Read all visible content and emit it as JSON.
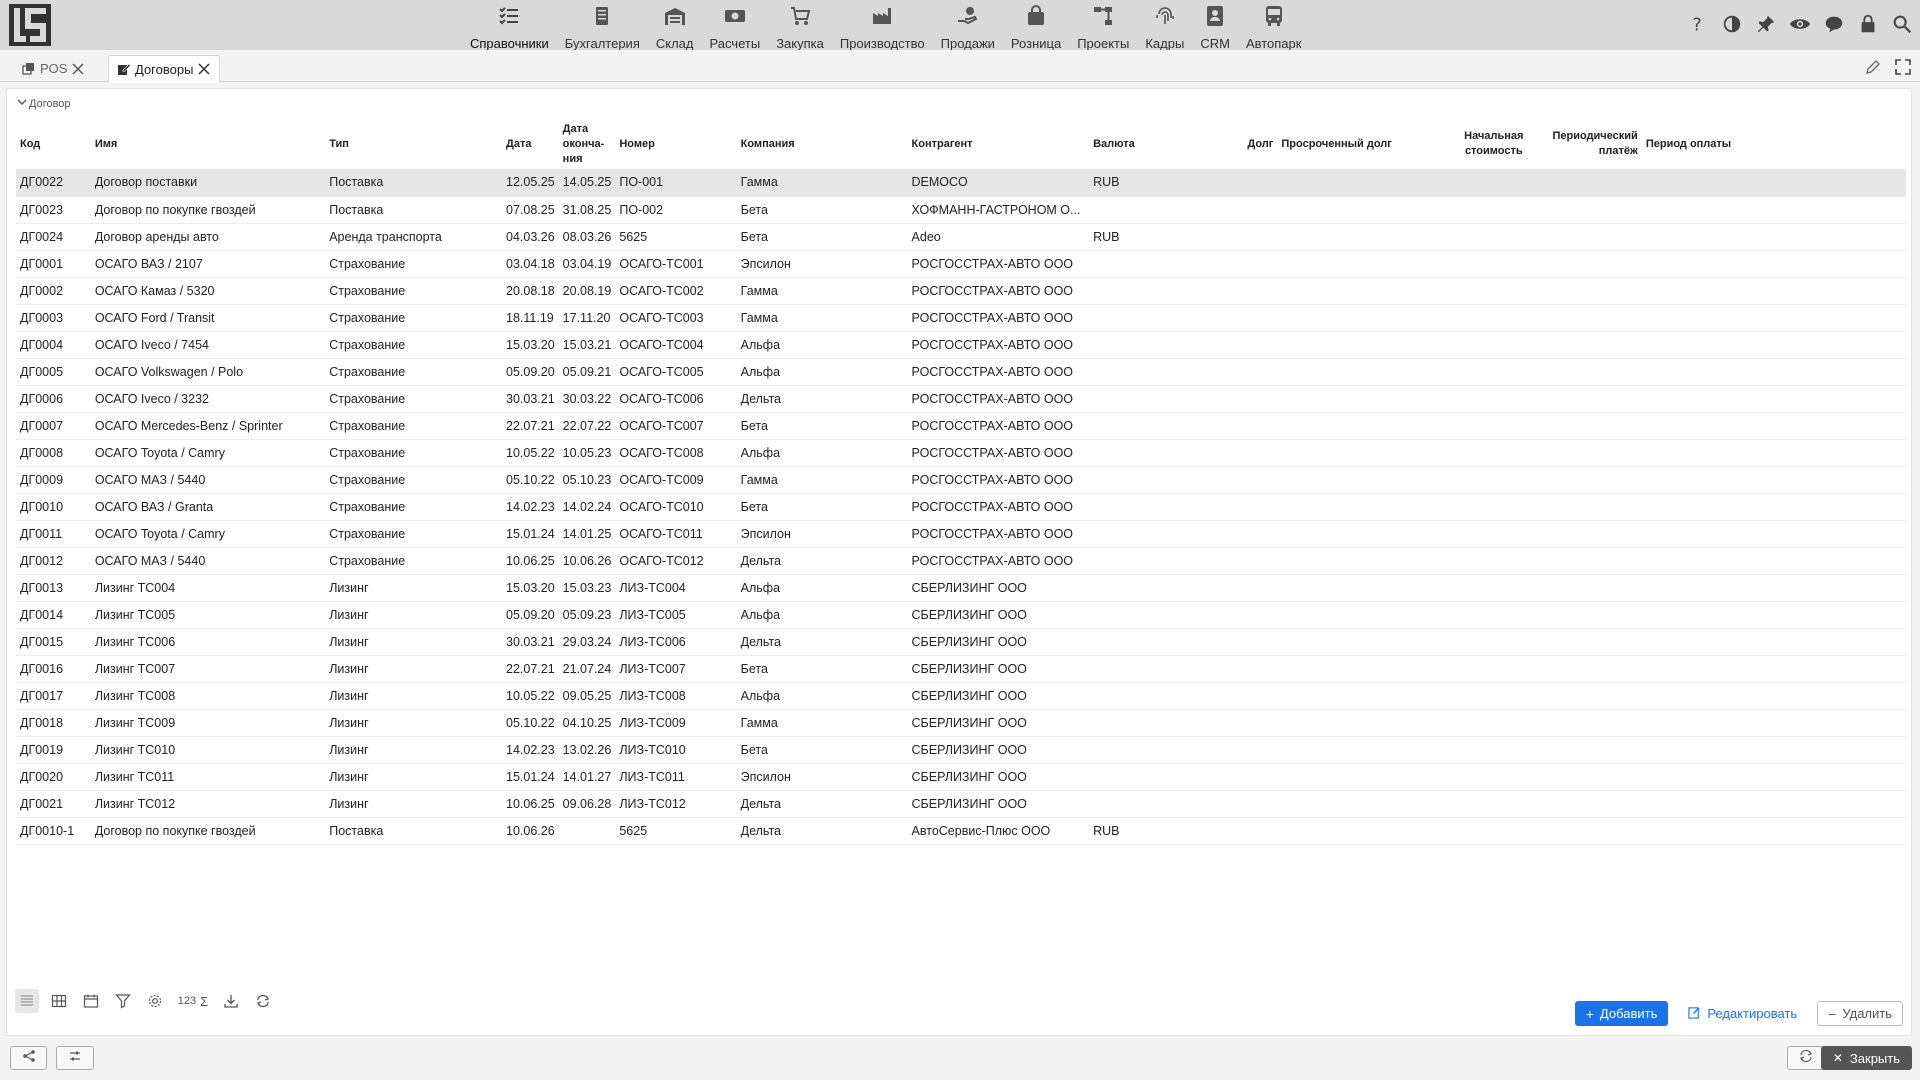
{
  "header": {
    "modules": [
      {
        "label": "Справочники",
        "icon": "list-check-icon"
      },
      {
        "label": "Бухгалтерия",
        "icon": "ledger-icon"
      },
      {
        "label": "Склад",
        "icon": "warehouse-icon"
      },
      {
        "label": "Расчеты",
        "icon": "cash-icon"
      },
      {
        "label": "Закупка",
        "icon": "cart-icon"
      },
      {
        "label": "Производство",
        "icon": "factory-icon"
      },
      {
        "label": "Продажи",
        "icon": "hand-money-icon"
      },
      {
        "label": "Розница",
        "icon": "shopping-bag-icon"
      },
      {
        "label": "Проекты",
        "icon": "project-icon"
      },
      {
        "label": "Кадры",
        "icon": "fingerprint-icon"
      },
      {
        "label": "CRM",
        "icon": "contact-card-icon"
      },
      {
        "label": "Автопарк",
        "icon": "bus-icon"
      }
    ]
  },
  "tabs": [
    {
      "label": "POS"
    },
    {
      "label": "Договоры"
    }
  ],
  "section_title": "Договор",
  "table": {
    "columns": [
      "Код",
      "Имя",
      "Тип",
      "Дата",
      "Дата оконча-ния",
      "Номер",
      "Компания",
      "Контрагент",
      "Валюта",
      "Долг",
      "Просроченный долг",
      "Начальная стоимость",
      "Периодический платёж",
      "Период оплаты"
    ],
    "rows": [
      [
        "ДГ0022",
        "Договор поставки",
        "Поставка",
        "12.05.25",
        "14.05.25",
        "ПО-001",
        "Гамма",
        "DEMOCO",
        "RUB"
      ],
      [
        "ДГ0023",
        "Договор по покупке гвоздей",
        "Поставка",
        "07.08.25",
        "31.08.25",
        "ПО-002",
        "Бета",
        "ХОФМАНН-ГАСТРОНОМ О...",
        ""
      ],
      [
        "ДГ0024",
        "Договор аренды авто",
        "Аренда транспорта",
        "04.03.26",
        "08.03.26",
        "5625",
        "Бета",
        "Adeo",
        "RUB"
      ],
      [
        "ДГ0001",
        "ОСАГО ВАЗ / 2107",
        "Страхование",
        "03.04.18",
        "03.04.19",
        "ОСАГО-ТС001",
        "Эпсилон",
        "РОСГОССТРАХ-АВТО ООО",
        ""
      ],
      [
        "ДГ0002",
        "ОСАГО Камаз / 5320",
        "Страхование",
        "20.08.18",
        "20.08.19",
        "ОСАГО-ТС002",
        "Гамма",
        "РОСГОССТРАХ-АВТО ООО",
        ""
      ],
      [
        "ДГ0003",
        "ОСАГО Ford / Transit",
        "Страхование",
        "18.11.19",
        "17.11.20",
        "ОСАГО-ТС003",
        "Гамма",
        "РОСГОССТРАХ-АВТО ООО",
        ""
      ],
      [
        "ДГ0004",
        "ОСАГО Iveco / 7454",
        "Страхование",
        "15.03.20",
        "15.03.21",
        "ОСАГО-ТС004",
        "Альфа",
        "РОСГОССТРАХ-АВТО ООО",
        ""
      ],
      [
        "ДГ0005",
        "ОСАГО Volkswagen / Polo",
        "Страхование",
        "05.09.20",
        "05.09.21",
        "ОСАГО-ТС005",
        "Альфа",
        "РОСГОССТРАХ-АВТО ООО",
        ""
      ],
      [
        "ДГ0006",
        "ОСАГО Iveco / 3232",
        "Страхование",
        "30.03.21",
        "30.03.22",
        "ОСАГО-ТС006",
        "Дельта",
        "РОСГОССТРАХ-АВТО ООО",
        ""
      ],
      [
        "ДГ0007",
        "ОСАГО Mercedes-Benz / Sprinter",
        "Страхование",
        "22.07.21",
        "22.07.22",
        "ОСАГО-ТС007",
        "Бета",
        "РОСГОССТРАХ-АВТО ООО",
        ""
      ],
      [
        "ДГ0008",
        "ОСАГО Toyota / Camry",
        "Страхование",
        "10.05.22",
        "10.05.23",
        "ОСАГО-ТС008",
        "Альфа",
        "РОСГОССТРАХ-АВТО ООО",
        ""
      ],
      [
        "ДГ0009",
        "ОСАГО МАЗ / 5440",
        "Страхование",
        "05.10.22",
        "05.10.23",
        "ОСАГО-ТС009",
        "Гамма",
        "РОСГОССТРАХ-АВТО ООО",
        ""
      ],
      [
        "ДГ0010",
        "ОСАГО ВАЗ / Granta",
        "Страхование",
        "14.02.23",
        "14.02.24",
        "ОСАГО-ТС010",
        "Бета",
        "РОСГОССТРАХ-АВТО ООО",
        ""
      ],
      [
        "ДГ0011",
        "ОСАГО Toyota / Camry",
        "Страхование",
        "15.01.24",
        "14.01.25",
        "ОСАГО-ТС011",
        "Эпсилон",
        "РОСГОССТРАХ-АВТО ООО",
        ""
      ],
      [
        "ДГ0012",
        "ОСАГО МАЗ / 5440",
        "Страхование",
        "10.06.25",
        "10.06.26",
        "ОСАГО-ТС012",
        "Дельта",
        "РОСГОССТРАХ-АВТО ООО",
        ""
      ],
      [
        "ДГ0013",
        "Лизинг ТС004",
        "Лизинг",
        "15.03.20",
        "15.03.23",
        "ЛИЗ-ТС004",
        "Альфа",
        "СБЕРЛИЗИНГ ООО",
        ""
      ],
      [
        "ДГ0014",
        "Лизинг ТС005",
        "Лизинг",
        "05.09.20",
        "05.09.23",
        "ЛИЗ-ТС005",
        "Альфа",
        "СБЕРЛИЗИНГ ООО",
        ""
      ],
      [
        "ДГ0015",
        "Лизинг ТС006",
        "Лизинг",
        "30.03.21",
        "29.03.24",
        "ЛИЗ-ТС006",
        "Дельта",
        "СБЕРЛИЗИНГ ООО",
        ""
      ],
      [
        "ДГ0016",
        "Лизинг ТС007",
        "Лизинг",
        "22.07.21",
        "21.07.24",
        "ЛИЗ-ТС007",
        "Бета",
        "СБЕРЛИЗИНГ ООО",
        ""
      ],
      [
        "ДГ0017",
        "Лизинг ТС008",
        "Лизинг",
        "10.05.22",
        "09.05.25",
        "ЛИЗ-ТС008",
        "Альфа",
        "СБЕРЛИЗИНГ ООО",
        ""
      ],
      [
        "ДГ0018",
        "Лизинг ТС009",
        "Лизинг",
        "05.10.22",
        "04.10.25",
        "ЛИЗ-ТС009",
        "Гамма",
        "СБЕРЛИЗИНГ ООО",
        ""
      ],
      [
        "ДГ0019",
        "Лизинг ТС010",
        "Лизинг",
        "14.02.23",
        "13.02.26",
        "ЛИЗ-ТС010",
        "Бета",
        "СБЕРЛИЗИНГ ООО",
        ""
      ],
      [
        "ДГ0020",
        "Лизинг ТС011",
        "Лизинг",
        "15.01.24",
        "14.01.27",
        "ЛИЗ-ТС011",
        "Эпсилон",
        "СБЕРЛИЗИНГ ООО",
        ""
      ],
      [
        "ДГ0021",
        "Лизинг ТС012",
        "Лизинг",
        "10.06.25",
        "09.06.28",
        "ЛИЗ-ТС012",
        "Дельта",
        "СБЕРЛИЗИНГ ООО",
        ""
      ],
      [
        "ДГ0010-1",
        "Договор по покупке гвоздей",
        "Поставка",
        "10.06.26",
        "",
        "5625",
        "Дельта",
        "АвтоСервис-Плюс ООО",
        "RUB"
      ]
    ]
  },
  "toolbar": {
    "digits_label": "123"
  },
  "actions": {
    "add_label": "Добавить",
    "edit_label": "Редактировать",
    "delete_label": "Удалить"
  },
  "footer": {
    "close_label": "Закрыть"
  },
  "colors": {
    "accent": "#1a73e8",
    "topbar": "#d9d9d9",
    "close_button": "#555555"
  }
}
